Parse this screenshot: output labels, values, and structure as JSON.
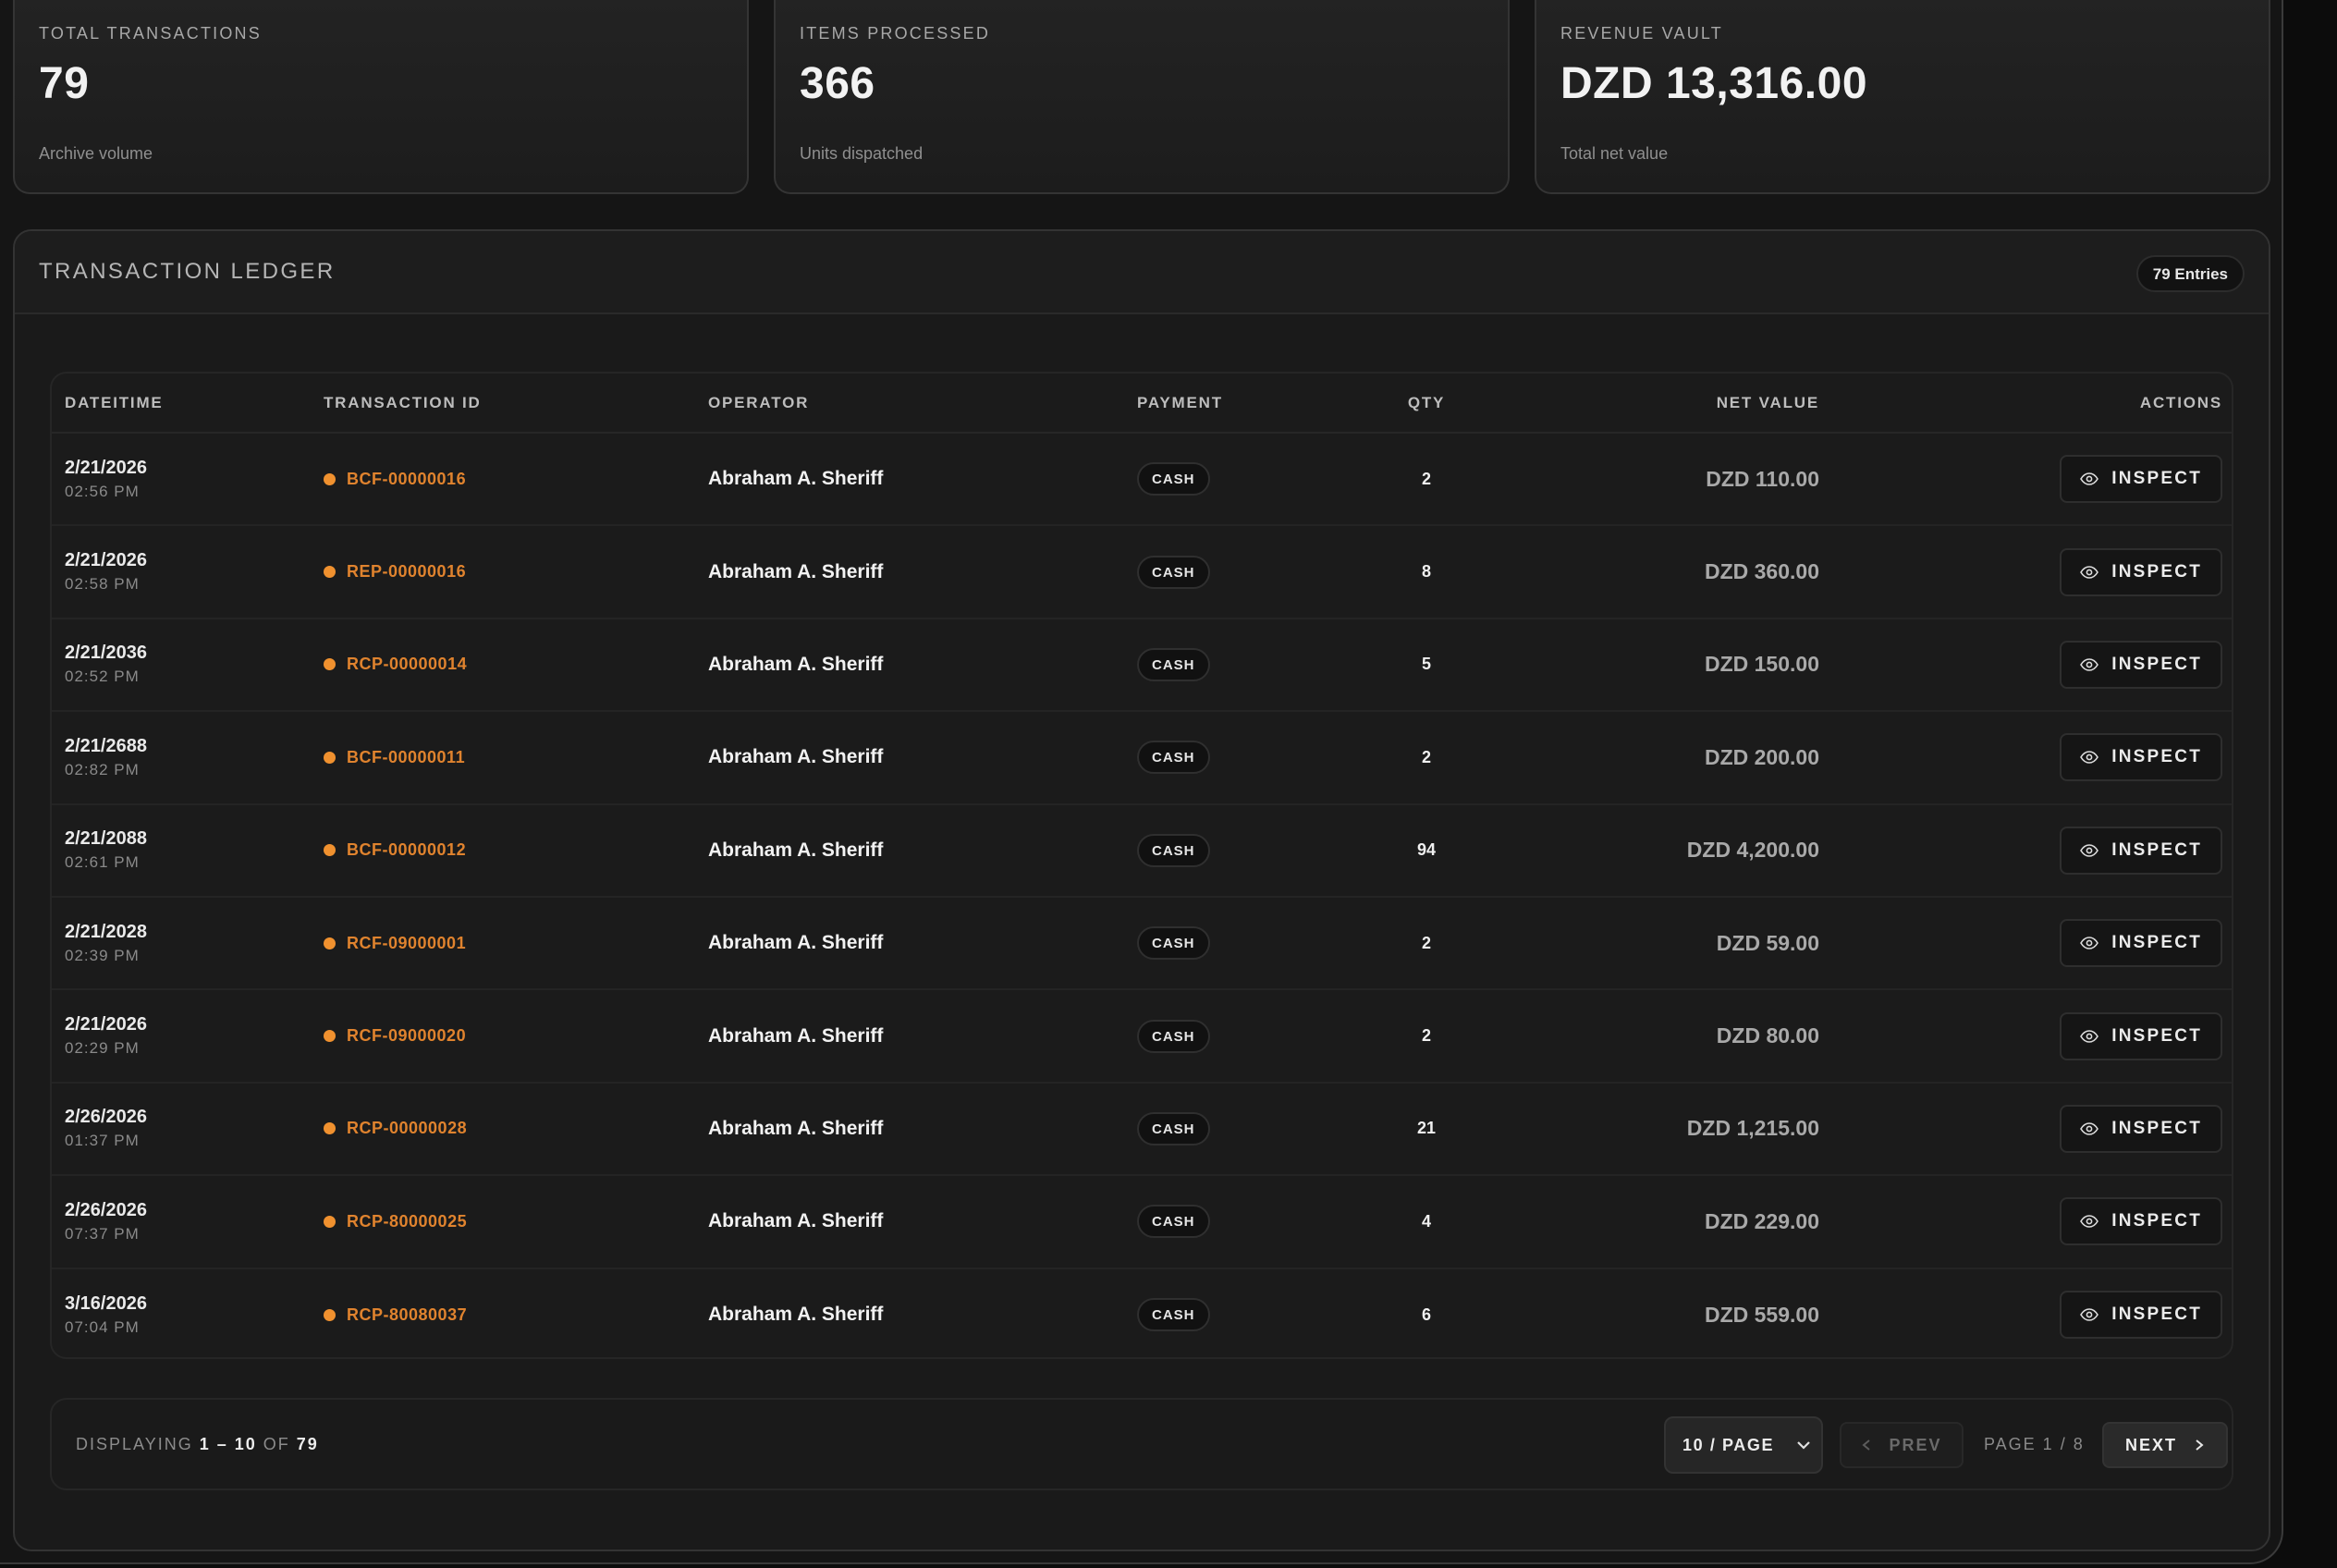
{
  "stats": [
    {
      "label": "TOTAL TRANSACTIONS",
      "value": "79",
      "sub": "Archive volume"
    },
    {
      "label": "ITEMS PROCESSED",
      "value": "366",
      "sub": "Units dispatched"
    },
    {
      "label": "REVENUE VAULT",
      "value": "DZD 13,316.00",
      "sub": "Total net value"
    }
  ],
  "ledger": {
    "title": "TRANSACTION LEDGER",
    "entries_badge": "79 Entries",
    "columns": [
      "DATEITIME",
      "TRANSACTION ID",
      "OPERATOR",
      "PAYMENT",
      "QTY",
      "NET VALUE",
      "ACTIONS"
    ],
    "action_label": "INSPECT",
    "rows": [
      {
        "date": "2/21/2026",
        "time": "02:56 PM",
        "txid": "BCF-00000016",
        "operator": "Abraham A. Sheriff",
        "payment": "CASH",
        "qty": "2",
        "net": "DZD 110.00"
      },
      {
        "date": "2/21/2026",
        "time": "02:58 PM",
        "txid": "REP-00000016",
        "operator": "Abraham A. Sheriff",
        "payment": "CASH",
        "qty": "8",
        "net": "DZD 360.00"
      },
      {
        "date": "2/21/2036",
        "time": "02:52 PM",
        "txid": "RCP-00000014",
        "operator": "Abraham A. Sheriff",
        "payment": "CASH",
        "qty": "5",
        "net": "DZD 150.00"
      },
      {
        "date": "2/21/2688",
        "time": "02:82 PM",
        "txid": "BCF-00000011",
        "operator": "Abraham A. Sheriff",
        "payment": "CASH",
        "qty": "2",
        "net": "DZD 200.00"
      },
      {
        "date": "2/21/2088",
        "time": "02:61 PM",
        "txid": "BCF-00000012",
        "operator": "Abraham A. Sheriff",
        "payment": "CASH",
        "qty": "94",
        "net": "DZD 4,200.00"
      },
      {
        "date": "2/21/2028",
        "time": "02:39 PM",
        "txid": "RCF-09000001",
        "operator": "Abraham A. Sheriff",
        "payment": "CASH",
        "qty": "2",
        "net": "DZD 59.00"
      },
      {
        "date": "2/21/2026",
        "time": "02:29 PM",
        "txid": "RCF-09000020",
        "operator": "Abraham A. Sheriff",
        "payment": "CASH",
        "qty": "2",
        "net": "DZD 80.00"
      },
      {
        "date": "2/26/2026",
        "time": "01:37 PM",
        "txid": "RCP-00000028",
        "operator": "Abraham A. Sheriff",
        "payment": "CASH",
        "qty": "21",
        "net": "DZD 1,215.00"
      },
      {
        "date": "2/26/2026",
        "time": "07:37 PM",
        "txid": "RCP-80000025",
        "operator": "Abraham A. Sheriff",
        "payment": "CASH",
        "qty": "4",
        "net": "DZD 229.00"
      },
      {
        "date": "3/16/2026",
        "time": "07:04 PM",
        "txid": "RCP-80080037",
        "operator": "Abraham A. Sheriff",
        "payment": "CASH",
        "qty": "6",
        "net": "DZD 559.00"
      }
    ]
  },
  "pagination": {
    "displaying_prefix": "DISPLAYING",
    "range": "1 – 10",
    "of_word": "OF",
    "total": "79",
    "per_page": "10 / PAGE",
    "prev": "PREV",
    "page_info": "PAGE 1 / 8",
    "next": "NEXT"
  },
  "colors": {
    "accent": "#f0912f",
    "background": "#151515"
  },
  "icons": {
    "inspect": "eye-icon",
    "per_page": "chevron-down-icon",
    "prev": "chevron-left-icon",
    "next": "chevron-right-icon"
  }
}
